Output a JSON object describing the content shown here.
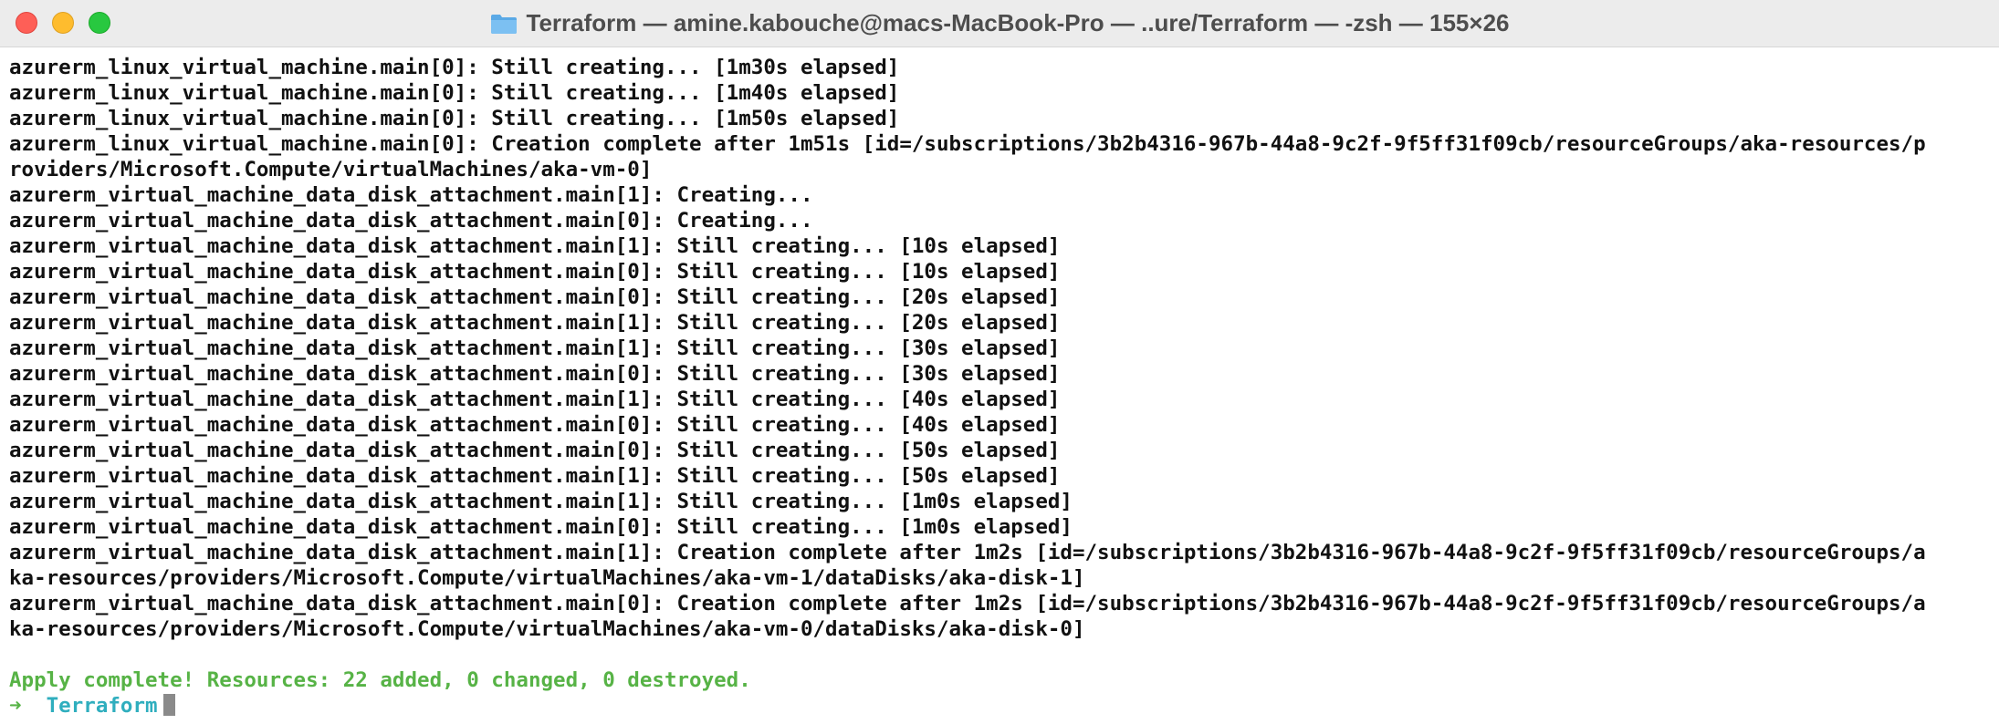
{
  "window": {
    "title": "Terraform — amine.kabouche@macs-MacBook-Pro — ..ure/Terraform — -zsh — 155×26",
    "folder_icon": "folder-icon",
    "colors": {
      "close": "#fe5f57",
      "minimize": "#febc2e",
      "maximize": "#28c840",
      "success_text": "#57b346",
      "prompt_dir": "#2faebe"
    }
  },
  "terminal": {
    "lines": [
      "azurerm_linux_virtual_machine.main[0]: Still creating... [1m30s elapsed]",
      "azurerm_linux_virtual_machine.main[0]: Still creating... [1m40s elapsed]",
      "azurerm_linux_virtual_machine.main[0]: Still creating... [1m50s elapsed]",
      "azurerm_linux_virtual_machine.main[0]: Creation complete after 1m51s [id=/subscriptions/3b2b4316-967b-44a8-9c2f-9f5ff31f09cb/resourceGroups/aka-resources/p",
      "roviders/Microsoft.Compute/virtualMachines/aka-vm-0]",
      "azurerm_virtual_machine_data_disk_attachment.main[1]: Creating...",
      "azurerm_virtual_machine_data_disk_attachment.main[0]: Creating...",
      "azurerm_virtual_machine_data_disk_attachment.main[1]: Still creating... [10s elapsed]",
      "azurerm_virtual_machine_data_disk_attachment.main[0]: Still creating... [10s elapsed]",
      "azurerm_virtual_machine_data_disk_attachment.main[0]: Still creating... [20s elapsed]",
      "azurerm_virtual_machine_data_disk_attachment.main[1]: Still creating... [20s elapsed]",
      "azurerm_virtual_machine_data_disk_attachment.main[1]: Still creating... [30s elapsed]",
      "azurerm_virtual_machine_data_disk_attachment.main[0]: Still creating... [30s elapsed]",
      "azurerm_virtual_machine_data_disk_attachment.main[1]: Still creating... [40s elapsed]",
      "azurerm_virtual_machine_data_disk_attachment.main[0]: Still creating... [40s elapsed]",
      "azurerm_virtual_machine_data_disk_attachment.main[0]: Still creating... [50s elapsed]",
      "azurerm_virtual_machine_data_disk_attachment.main[1]: Still creating... [50s elapsed]",
      "azurerm_virtual_machine_data_disk_attachment.main[1]: Still creating... [1m0s elapsed]",
      "azurerm_virtual_machine_data_disk_attachment.main[0]: Still creating... [1m0s elapsed]",
      "azurerm_virtual_machine_data_disk_attachment.main[1]: Creation complete after 1m2s [id=/subscriptions/3b2b4316-967b-44a8-9c2f-9f5ff31f09cb/resourceGroups/a",
      "ka-resources/providers/Microsoft.Compute/virtualMachines/aka-vm-1/dataDisks/aka-disk-1]",
      "azurerm_virtual_machine_data_disk_attachment.main[0]: Creation complete after 1m2s [id=/subscriptions/3b2b4316-967b-44a8-9c2f-9f5ff31f09cb/resourceGroups/a",
      "ka-resources/providers/Microsoft.Compute/virtualMachines/aka-vm-0/dataDisks/aka-disk-0]"
    ],
    "summary": "Apply complete! Resources: 22 added, 0 changed, 0 destroyed.",
    "prompt": {
      "arrow": "➜",
      "directory": "Terraform"
    }
  }
}
